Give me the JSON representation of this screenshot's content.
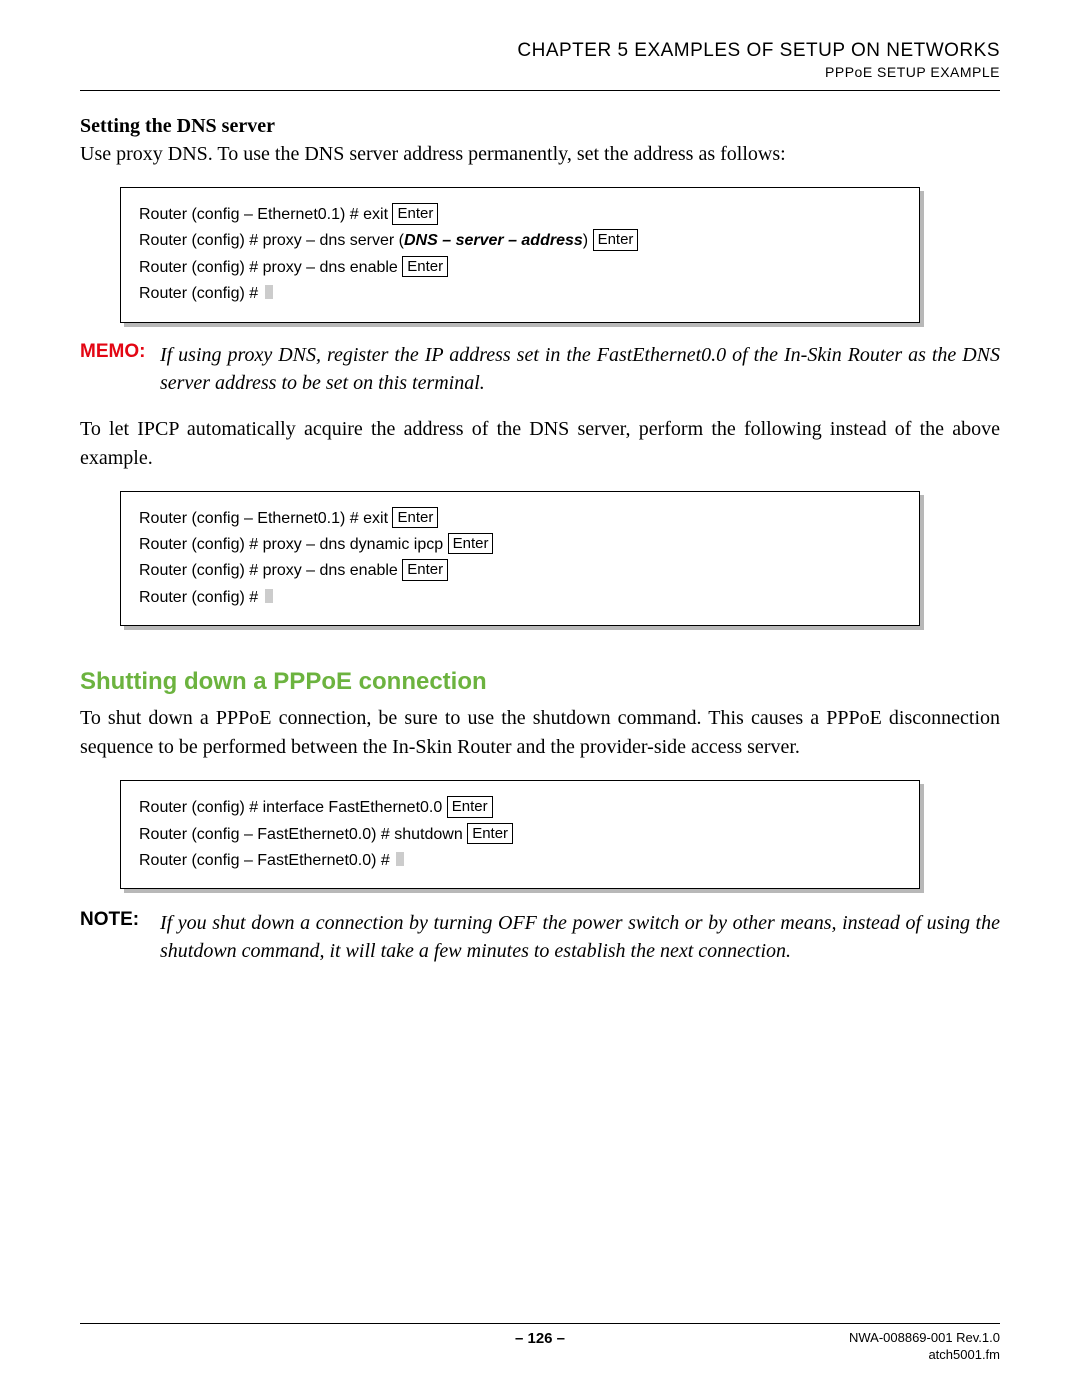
{
  "header": {
    "chapter": "CHAPTER 5   EXAMPLES OF SETUP ON NETWORKS",
    "sub": "PPPoE SETUP EXAMPLE"
  },
  "section1": {
    "title": "Setting the DNS server",
    "intro": "Use proxy DNS. To use the DNS server address permanently, set the address as follows:"
  },
  "code1": {
    "l1a": "Router (config – Ethernet0.1) # exit ",
    "l2a": "Router (config) # proxy – dns server (",
    "l2b": "DNS – server – address",
    "l2c": ") ",
    "l3a": "Router (config) # proxy – dns enable ",
    "l4a": "Router (config) # "
  },
  "enter": "Enter",
  "memo": {
    "label": "MEMO:",
    "text": "If using proxy DNS, register the IP address set in the FastEthernet0.0 of the In-Skin Router as the DNS server address to be set on this terminal."
  },
  "para2": "To let IPCP automatically acquire the address of the DNS server, perform the following instead of the above example.",
  "code2": {
    "l1": "Router (config – Ethernet0.1) # exit ",
    "l2": "Router (config) # proxy – dns dynamic ipcp ",
    "l3": "Router (config) # proxy – dns enable ",
    "l4": "Router (config) # "
  },
  "h2": "Shutting down a PPPoE connection",
  "para3": "To shut down a PPPoE connection, be sure to use the shutdown command. This causes a PPPoE disconnection sequence to be performed between the In-Skin Router and the provider-side access server.",
  "code3": {
    "l1": "Router (config) # interface FastEthernet0.0 ",
    "l2": "Router (config – FastEthernet0.0) # shutdown ",
    "l3": "Router (config – FastEthernet0.0) # "
  },
  "note": {
    "label": "NOTE:",
    "text": "If you shut down a connection by turning OFF the power switch or by other means, instead of using the shutdown command, it will take a few minutes to establish the next connection."
  },
  "footer": {
    "page": "– 126 –",
    "doc": "NWA-008869-001 Rev.1.0",
    "file": "atch5001.fm"
  }
}
